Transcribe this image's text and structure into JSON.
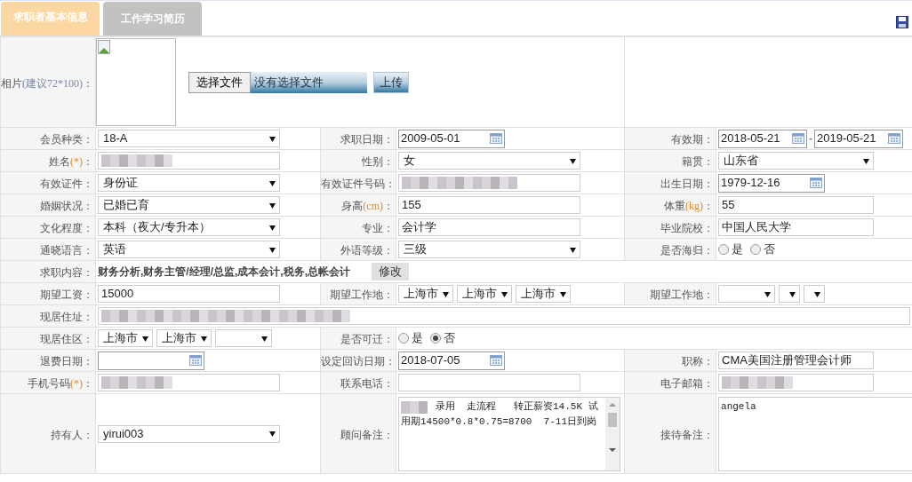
{
  "tabs": [
    {
      "label": "求职者基本信息",
      "selected": true
    },
    {
      "label": "工作学习简历",
      "selected": false
    }
  ],
  "photo": {
    "label": "相片",
    "label_note": "(建议72*100)",
    "label_after": "：",
    "choose_button": "选择文件",
    "file_status": "没有选择文件",
    "upload_button": "上传"
  },
  "rows": [
    {
      "cells": [
        {
          "label": "会员种类：",
          "field": {
            "kind": "select",
            "value": "18-A"
          }
        },
        {
          "label": "求职日期：",
          "field": {
            "kind": "date",
            "value": "2009-05-01"
          }
        },
        {
          "label": "有效期：",
          "field": {
            "kind": "date_range",
            "from": "2018-05-21",
            "separator": "-",
            "to": "2019-05-21"
          }
        }
      ]
    },
    {
      "cells": [
        {
          "label": "姓名",
          "label_note": "(*)",
          "label_after": "：",
          "field": {
            "kind": "text",
            "redacted": true
          }
        },
        {
          "label": "性别：",
          "field": {
            "kind": "select",
            "value": "女"
          }
        },
        {
          "label": "籍贯：",
          "field": {
            "kind": "select",
            "value": "山东省"
          }
        }
      ]
    },
    {
      "cells": [
        {
          "label": "有效证件：",
          "field": {
            "kind": "select",
            "value": "身份证"
          }
        },
        {
          "label": "有效证件号码：",
          "field": {
            "kind": "text",
            "redacted": true
          }
        },
        {
          "label": "出生日期：",
          "field": {
            "kind": "date",
            "value": "1979-12-16"
          }
        }
      ]
    },
    {
      "cells": [
        {
          "label": "婚姻状况：",
          "field": {
            "kind": "select",
            "value": "已婚已育"
          }
        },
        {
          "label": "身高",
          "label_note": "(cm)",
          "label_after": "：",
          "field": {
            "kind": "text",
            "value": "155"
          }
        },
        {
          "label": "体重",
          "label_note": "(kg)",
          "label_after": "：",
          "field": {
            "kind": "text",
            "value": "55"
          }
        }
      ]
    },
    {
      "cells": [
        {
          "label": "文化程度：",
          "field": {
            "kind": "select",
            "value": "本科（夜大/专升本）"
          }
        },
        {
          "label": "专业：",
          "field": {
            "kind": "text",
            "value": "会计学"
          }
        },
        {
          "label": "毕业院校：",
          "field": {
            "kind": "text",
            "value": "中国人民大学"
          }
        }
      ]
    },
    {
      "cells": [
        {
          "label": "通晓语言：",
          "field": {
            "kind": "select",
            "value": "英语"
          }
        },
        {
          "label": "外语等级：",
          "field": {
            "kind": "select",
            "value": "三级"
          }
        },
        {
          "label": "是否海归：",
          "field": {
            "kind": "radio",
            "options": [
              {
                "label": "是",
                "selected": false
              },
              {
                "label": "否",
                "selected": false
              }
            ]
          }
        }
      ]
    },
    {
      "cells": [
        {
          "label": "求职内容：",
          "field": {
            "kind": "tags",
            "text": "财务分析,财务主管/经理/总监,成本会计,税务,总帐会计",
            "button": "修改"
          }
        }
      ]
    },
    {
      "cells": [
        {
          "label": "期望工资：",
          "field": {
            "kind": "text",
            "value": "15000"
          }
        },
        {
          "label": "期望工作地：",
          "field": {
            "kind": "selects",
            "items": [
              {
                "kind": "filled",
                "value": "上海市"
              },
              {
                "kind": "filled",
                "value": "上海市"
              },
              {
                "kind": "filled",
                "value": "上海市"
              }
            ]
          }
        },
        {
          "label": "期望工作地：",
          "field": {
            "kind": "selects",
            "items": [
              {
                "kind": "blank"
              },
              {
                "kind": "blank"
              },
              {
                "kind": "blank"
              }
            ]
          }
        }
      ]
    },
    {
      "cells": [
        {
          "label": "现居住址：",
          "field": {
            "kind": "wide_text",
            "redacted": true
          }
        }
      ]
    },
    {
      "cells": [
        {
          "label": "现居住区：",
          "field": {
            "kind": "selects",
            "items": [
              {
                "kind": "filled",
                "value": "上海市"
              },
              {
                "kind": "filled",
                "value": "上海市"
              },
              {
                "kind": "blank"
              }
            ]
          }
        },
        {
          "label": "是否可迁：",
          "field": {
            "kind": "radio",
            "options": [
              {
                "label": "是",
                "selected": false
              },
              {
                "label": "否",
                "selected": true
              }
            ]
          }
        }
      ]
    },
    {
      "cells": [
        {
          "label": "退费日期：",
          "field": {
            "kind": "date"
          }
        },
        {
          "label": "设定回访日期：",
          "field": {
            "kind": "date",
            "value": "2018-07-05"
          }
        },
        {
          "label": "职称：",
          "field": {
            "kind": "text",
            "value": "CMA美国注册管理会计师"
          }
        }
      ]
    },
    {
      "cells": [
        {
          "label": "手机号码",
          "label_note": "(*)",
          "label_after": "：",
          "field": {
            "kind": "text",
            "redacted": true
          }
        },
        {
          "label": "联系电话：",
          "field": {
            "kind": "text"
          }
        },
        {
          "label": "电子邮箱：",
          "field": {
            "kind": "text",
            "redacted": true
          }
        }
      ]
    },
    {
      "cells": [
        {
          "label": "持有人：",
          "field": {
            "kind": "select",
            "value": "yirui003"
          }
        },
        {
          "label": "顾问备注：",
          "field": {
            "kind": "textarea",
            "redacted_prefix": true,
            "value": "录用  走流程   转正薪资14.5K 试用期14500*0.8*0.75=8700  7-11日到岗",
            "scrollable": true
          }
        },
        {
          "label": "接待备注：",
          "field": {
            "kind": "textarea",
            "value": "angela",
            "scrollable": false
          }
        }
      ]
    }
  ]
}
